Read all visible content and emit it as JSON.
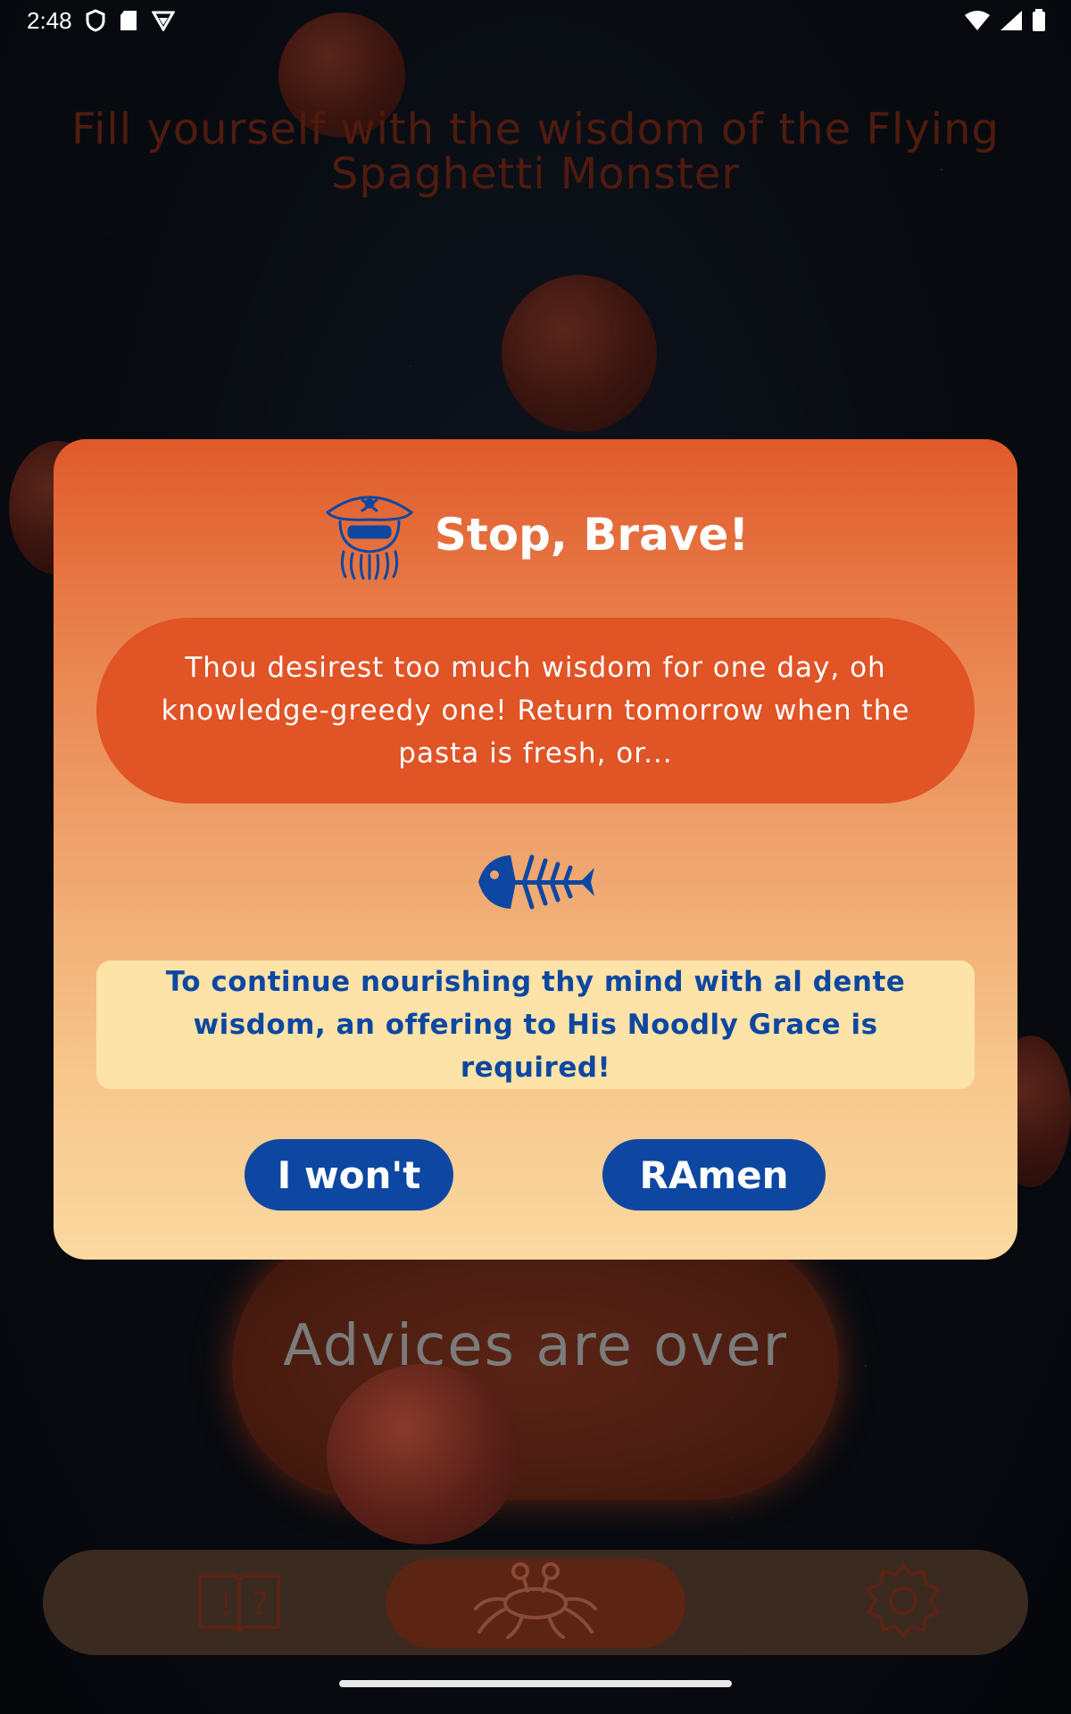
{
  "status_bar": {
    "time": "2:48",
    "icons_left": [
      "shield-icon",
      "sd-card-icon",
      "vpn-icon"
    ],
    "icons_right": [
      "wifi-icon",
      "signal-icon",
      "battery-icon"
    ]
  },
  "background": {
    "title": "Fill yourself with the wisdom of the Flying Spaghetti Monster",
    "advice_button_label": "Advices are over"
  },
  "dialog": {
    "header_icon": "pirate-octopus-icon",
    "title": "Stop, Brave!",
    "message": "Thou desirest too much wisdom for one day, oh knowledge-greedy one! Return tomorrow when the pasta is fresh, or...",
    "divider_icon": "fish-skeleton-icon",
    "offer_text": "To continue nourishing thy mind with al dente wisdom, an offering to His Noodly Grace is required!",
    "decline_label": "I won't",
    "accept_label": "RAmen"
  },
  "bottom_nav": {
    "items": [
      {
        "icon": "book-icon",
        "active": false
      },
      {
        "icon": "flying-spaghetti-monster-icon",
        "active": true
      },
      {
        "icon": "settings-gear-icon",
        "active": false
      }
    ]
  },
  "colors": {
    "dialog_top": "#e05a2a",
    "dialog_bottom": "#fbd9a0",
    "accent_blue": "#0d47a1",
    "message_pill": "#e05426",
    "offer_box": "#fde3a8"
  }
}
